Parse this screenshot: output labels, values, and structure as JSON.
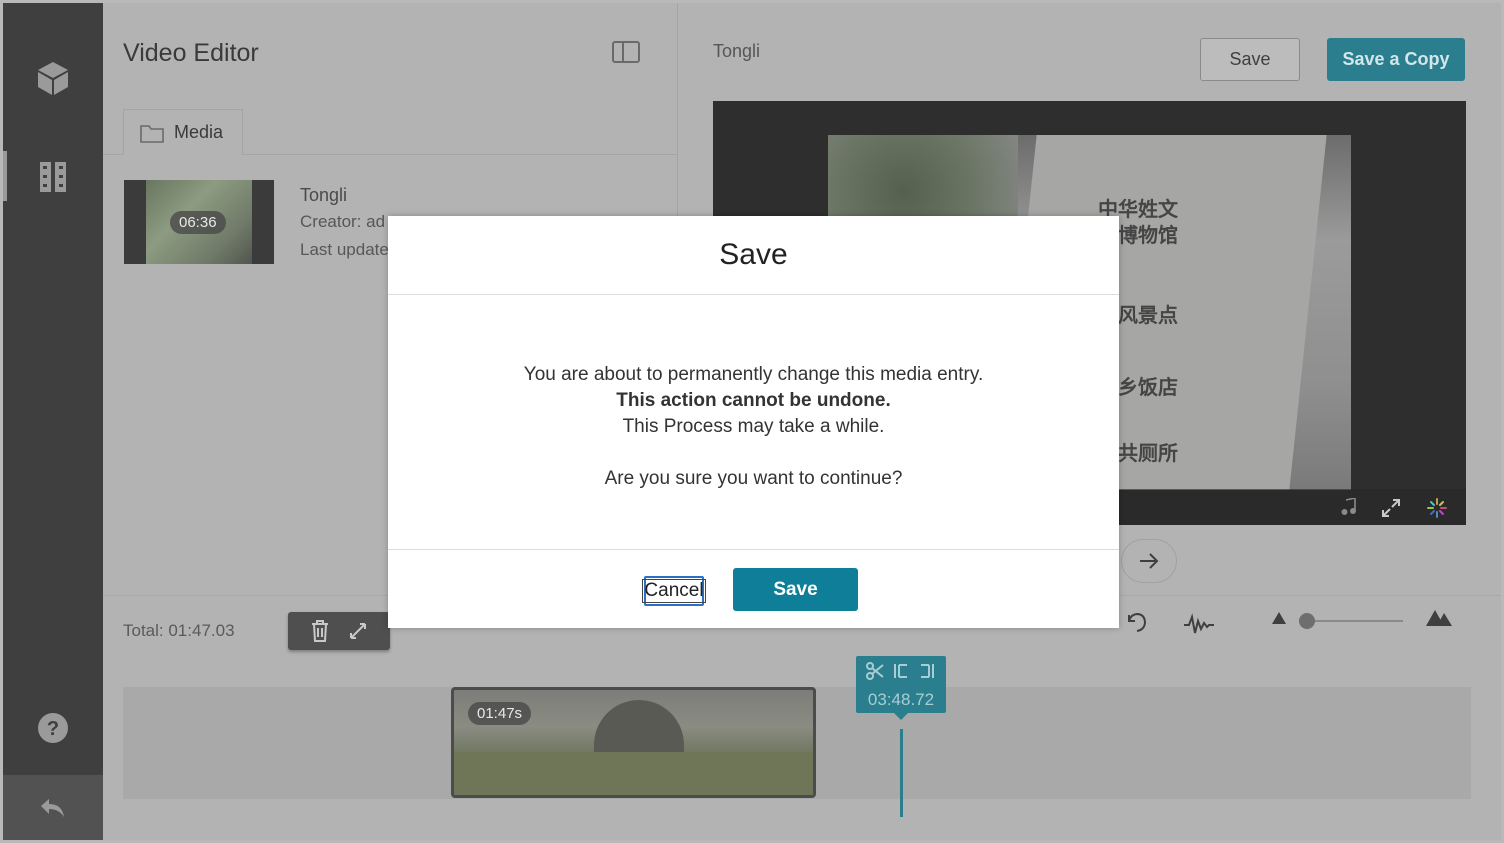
{
  "app": {
    "panel_title": "Video Editor",
    "media_tab_label": "Media",
    "nav": {
      "top_icon": "cube-icon",
      "second_icon": "film-icon",
      "help_icon": "help-icon",
      "back_icon": "undo-arrow-icon"
    }
  },
  "entry": {
    "thumbnail_duration": "06:36",
    "name": "Tongli",
    "creator": "Creator: ad",
    "last_updated": "Last update"
  },
  "player": {
    "title": "Tongli",
    "save_label": "Save",
    "save_copy_label": "Save a Copy",
    "sign_glyphs": [
      "中华姓文",
      "博物馆",
      "风景点",
      "乡饭店",
      "共厕所"
    ]
  },
  "timeline": {
    "total_label": "Total: 01:47.03",
    "clip_duration": "01:47s",
    "playhead_time": "03:48.72"
  },
  "modal": {
    "title": "Save",
    "line1": "You are about to permanently change this media entry.",
    "line2": "This action cannot be undone.",
    "line3": "This Process may take a while.",
    "line4": "Are you sure you want to continue?",
    "cancel_label": "Cancel",
    "save_label": "Save"
  },
  "colors": {
    "accent": "#0f7e98",
    "overlay_accent": "#2a7e8e",
    "rail": "#3f3f3f"
  }
}
